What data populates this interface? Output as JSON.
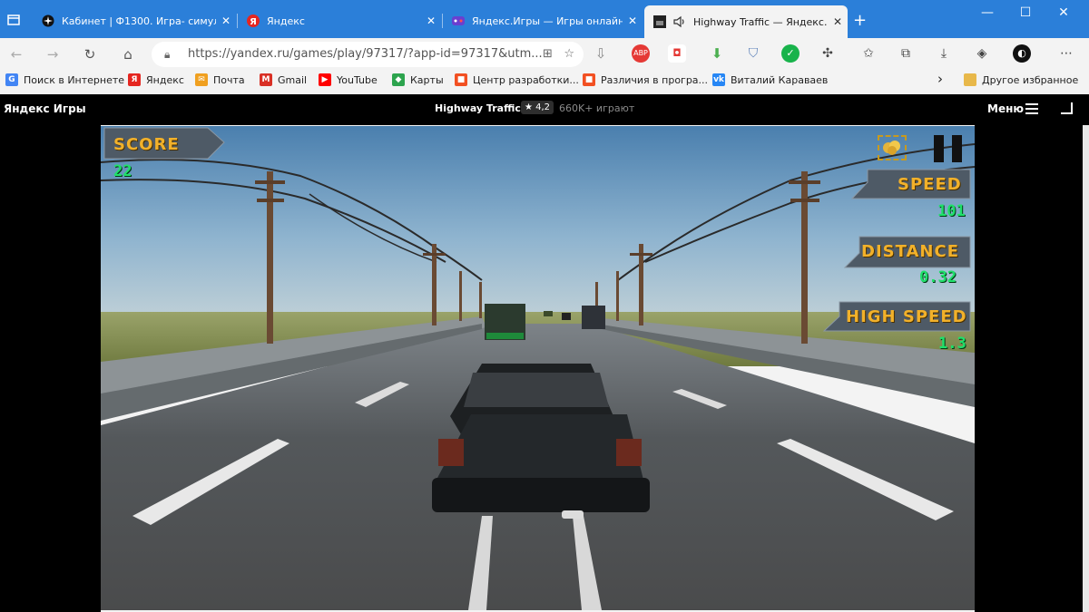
{
  "browser": {
    "tabs": [
      {
        "title": "Кабинет | Ф1300. Игра- симуля",
        "close": "✕"
      },
      {
        "title": "Яндекс",
        "close": "✕"
      },
      {
        "title": "Яндекс.Игры — Игры онлайн б",
        "close": "✕"
      },
      {
        "title": "Highway Traffic — Яндекс.И",
        "close": "✕",
        "active": true
      }
    ],
    "new_tab": "+",
    "window_controls": {
      "minimize": "—",
      "maximize": "☐",
      "close": "✕"
    },
    "url": "https://yandex.ru/games/play/97317/?app-id=97317&utm...",
    "bookmarks": [
      {
        "label": "Поиск в Интернете",
        "icon_color": "#4285f4",
        "icon_text": "G"
      },
      {
        "label": "Яндекс",
        "icon_color": "#e52620",
        "icon_text": "Я"
      },
      {
        "label": "Почта",
        "icon_color": "#f0a020",
        "icon_text": "✉"
      },
      {
        "label": "Gmail",
        "icon_color": "#d93025",
        "icon_text": "M"
      },
      {
        "label": "YouTube",
        "icon_color": "#ff0000",
        "icon_text": "▶"
      },
      {
        "label": "Карты",
        "icon_color": "#2da44e",
        "icon_text": "◆"
      },
      {
        "label": "Центр разработки...",
        "icon_color": "#f25022",
        "icon_text": "■"
      },
      {
        "label": "Различия в програ...",
        "icon_color": "#f25022",
        "icon_text": "■"
      },
      {
        "label": "Виталий Караваев",
        "icon_color": "#2787f5",
        "icon_text": "vk"
      }
    ],
    "bookmarks_more": "›",
    "other_favorites": "Другое избранное",
    "colors": {
      "tabbar": "#2b7fd9",
      "chrome": "#f3f3f3"
    }
  },
  "game_page": {
    "brand": "Яндекс Игры",
    "game_title": "Highway Traffic",
    "rating": "★ 4,2",
    "players": "660K+ играют",
    "menu_label": "Меню"
  },
  "hud": {
    "score_label": "SCORE",
    "score_value": "22",
    "speed_label": "SPEED",
    "speed_value": "101",
    "distance_label": "DISTANCE",
    "distance_value": "0.32",
    "high_speed_label": "HIGH SPEED",
    "high_speed_value": "1.3",
    "label_color": "#f2b12a",
    "value_color": "#1fe06a"
  }
}
